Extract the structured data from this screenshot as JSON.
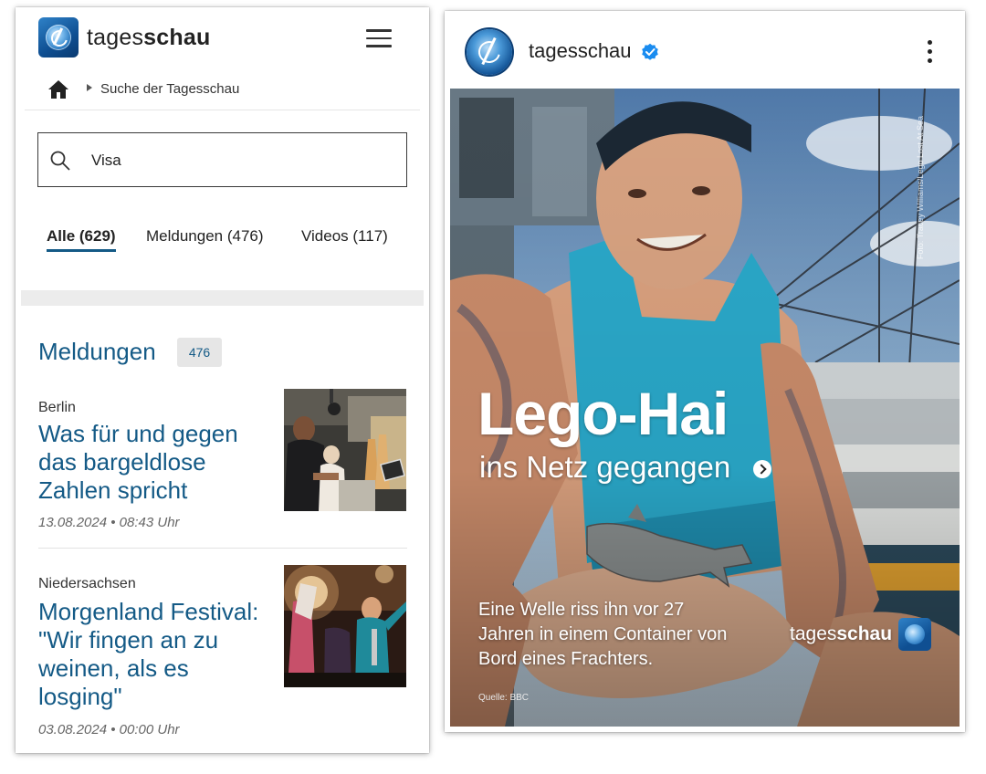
{
  "left": {
    "header": {
      "brand_light": "tages",
      "brand_bold": "schau"
    },
    "breadcrumb": {
      "label": "Suche der Tagesschau"
    },
    "search": {
      "value": "Visa"
    },
    "tabs": [
      {
        "label": "Alle (629)",
        "active": true
      },
      {
        "label": "Meldungen (476)",
        "active": false
      },
      {
        "label": "Videos (117)",
        "active": false
      }
    ],
    "section": {
      "title": "Meldungen",
      "count": "476"
    },
    "articles": [
      {
        "location": "Berlin",
        "headline": "Was für und gegen das bargeldlose Zahlen spricht",
        "date": "13.08.2024 • 08:43 Uhr"
      },
      {
        "location": "Niedersachsen",
        "headline": "Morgenland Festival: \"Wir fingen an zu weinen, als es losging\"",
        "date": "03.08.2024 • 00:00 Uhr"
      }
    ]
  },
  "right": {
    "header": {
      "account_name": "tagesschau",
      "verified": true
    },
    "story": {
      "title": "Lego-Hai",
      "subtitle": "ins Netz gegangen",
      "body": "Eine Welle riss ihn vor 27 Jahren in einem Container von Bord eines Frachters.",
      "source": "Quelle: BBC",
      "brand_light": "tages",
      "brand_bold": "schau",
      "photo_credit": "Foto: Tracey Williams/Lego Lost At Sea"
    }
  },
  "colors": {
    "brand_blue": "#145a86",
    "verified_blue": "#1a8cf0",
    "tab_underline": "#145a86"
  }
}
